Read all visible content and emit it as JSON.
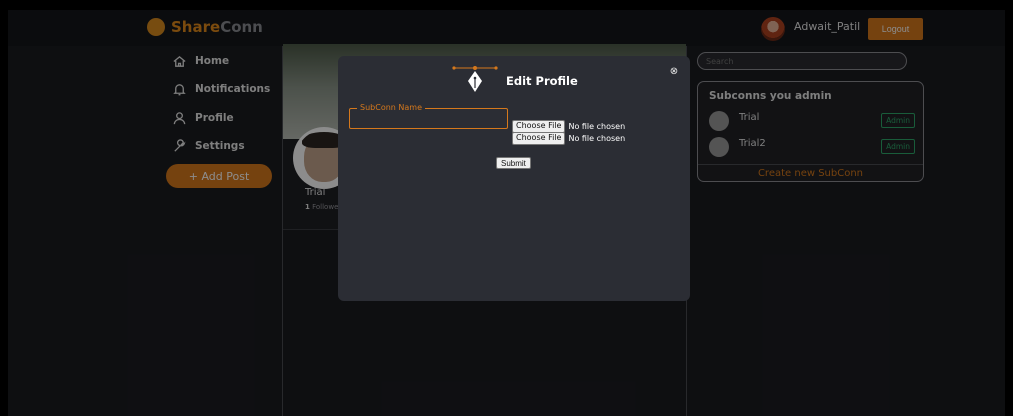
{
  "brand": {
    "share": "Share",
    "conn": "Conn"
  },
  "user": {
    "name": "Adwait_Patil",
    "logout_label": "Logout"
  },
  "sidebar": {
    "items": [
      {
        "label": "Home",
        "icon": "home-icon"
      },
      {
        "label": "Notifications",
        "icon": "bell-icon"
      },
      {
        "label": "Profile",
        "icon": "user-icon"
      },
      {
        "label": "Settings",
        "icon": "settings-icon"
      }
    ],
    "add_post_label": "+ Add Post"
  },
  "subconn": {
    "name": "Trial",
    "followers_count": "1",
    "followers_label": "Followers"
  },
  "right": {
    "search_placeholder": "Search",
    "admin_title": "Subconns you admin",
    "admins": [
      {
        "name": "Trial",
        "badge": "Admin"
      },
      {
        "name": "Trial2",
        "badge": "Admin"
      }
    ],
    "create_label": "Create new SubConn"
  },
  "modal": {
    "title": "Edit Profile",
    "field_label": "SubConn Name",
    "field_value": "",
    "file_rows": [
      {
        "button": "Choose File",
        "status": "No file chosen"
      },
      {
        "button": "Choose File",
        "status": "No file chosen"
      }
    ],
    "submit_label": "Submit",
    "close_icon": "close-circle-icon"
  },
  "colors": {
    "accent": "#d5781c",
    "admin_green": "#2fa86a",
    "background": "#1b1c20",
    "modal": "#2b2d34"
  }
}
